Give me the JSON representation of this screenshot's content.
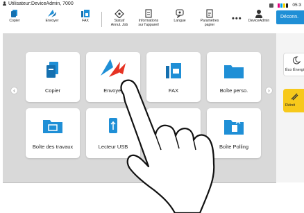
{
  "status": {
    "user": "Utilisateur:DeviceAdmin, 7000",
    "time": "05:3",
    "strip_colors": [
      "#e6007e",
      "#00a0e9",
      "#f5d300",
      "#222222"
    ]
  },
  "toolbar": {
    "copy": "Copier",
    "send": "Envoyer",
    "fax": "FAX",
    "job_status_1": "Statut/",
    "job_status_2": "Annul. Job",
    "device_info_1": "Informations",
    "device_info_2": "sur l'appareil",
    "language": "Langue",
    "paper_1": "Paramètres",
    "paper_2": "papier",
    "more": "•••",
    "account": "DeviceAdmin",
    "logout": "Déconn."
  },
  "tiles": [
    {
      "label": "Copier",
      "icon": "copy-icon"
    },
    {
      "label": "Envoyer",
      "icon": "send-icon"
    },
    {
      "label": "FAX",
      "icon": "fax-icon"
    },
    {
      "label": "Boîte perso.",
      "icon": "folder-icon"
    },
    {
      "label": "Boîte des travaux",
      "icon": "job-box-icon"
    },
    {
      "label": "Lecteur USB",
      "icon": "usb-icon"
    },
    {
      "label": "",
      "icon": "hidden"
    },
    {
      "label": "Boîte Polling",
      "icon": "polling-box-icon"
    }
  ],
  "side": {
    "eco": "Éco Énergie",
    "reset": "Réinit"
  },
  "colors": {
    "accent": "#1f8fd6",
    "reset": "#f7c91b",
    "send_red": "#e63323"
  }
}
